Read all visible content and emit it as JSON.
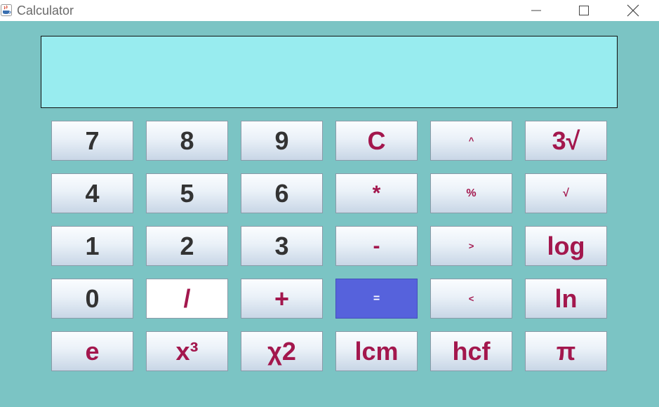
{
  "window": {
    "title": "Calculator",
    "minimize_icon": "minimize-icon",
    "maximize_icon": "maximize-icon",
    "close_icon": "close-icon",
    "app_icon": "java-cup-icon"
  },
  "display": {
    "value": ""
  },
  "colors": {
    "background": "#7bc4c4",
    "display_bg": "#98ecef",
    "digit_text": "#333333",
    "op_text": "#a3174d",
    "equals_bg": "#5662dc"
  },
  "keys": {
    "row1": [
      "7",
      "8",
      "9",
      "C",
      "^",
      "3√"
    ],
    "row2": [
      "4",
      "5",
      "6",
      "*",
      "%",
      "√"
    ],
    "row3": [
      "1",
      "2",
      "3",
      "-",
      ">",
      "log"
    ],
    "row4": [
      "0",
      "/",
      "+",
      "=",
      "<",
      "ln"
    ],
    "row5": [
      "e",
      "x³",
      "χ2",
      "lcm",
      "hcf",
      "π"
    ]
  }
}
